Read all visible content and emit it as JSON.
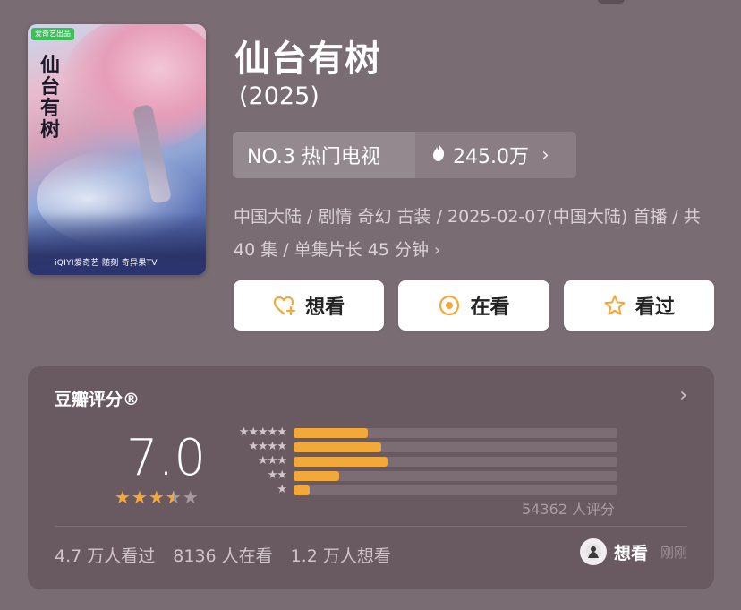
{
  "poster": {
    "badge": "爱奇艺出品",
    "calligraphy": "仙台有树",
    "logos": "iQIYI爱奇艺  随刻  奇异果TV"
  },
  "title": "仙台有树",
  "year": "(2025)",
  "rank": {
    "label": "NO.3 热门电视",
    "heat_icon": "flame-icon",
    "heat_value": "245.0万"
  },
  "meta": {
    "text": "中国大陆 / 剧情 奇幻 古装 / 2025-02-07(中国大陆) 首播 / 共 40 集 / 单集片长 45 分钟"
  },
  "actions": [
    {
      "label": "想看",
      "icon": "heart-plus-icon"
    },
    {
      "label": "在看",
      "icon": "target-circle-icon"
    },
    {
      "label": "看过",
      "icon": "star-outline-icon"
    }
  ],
  "rating": {
    "title": "豆瓣评分®",
    "score": "7.0",
    "stars_value": 3.5,
    "distribution": [
      {
        "stars": "★★★★★",
        "fraction": 0.23
      },
      {
        "stars": "★★★★",
        "fraction": 0.27
      },
      {
        "stars": "★★★",
        "fraction": 0.29
      },
      {
        "stars": "★★",
        "fraction": 0.14
      },
      {
        "stars": "★",
        "fraction": 0.05
      }
    ],
    "raters": "54362 人评分",
    "stats": [
      "4.7 万人看过",
      "8136 人在看",
      "1.2 万人想看"
    ],
    "friend": {
      "status": "想看",
      "time": "刚刚"
    }
  },
  "colors": {
    "background": "#7a6c73",
    "accent": "#f3a93a",
    "card": "#695a61"
  }
}
